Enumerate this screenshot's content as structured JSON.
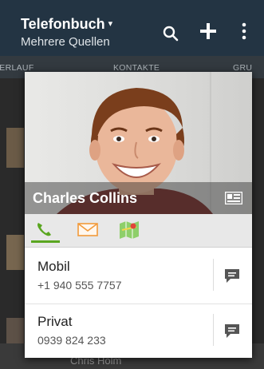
{
  "app": {
    "title": "Telefonbuch",
    "title_caret": "▾",
    "subtitle": "Mehrere Quellen",
    "search_icon": "search-icon",
    "add_icon": "plus-icon",
    "menu_icon": "overflow-menu-icon"
  },
  "tabs": [
    {
      "label": "VERLAUF (partially visible)"
    },
    {
      "label": "KONTAKTE"
    },
    {
      "label": "GRU"
    }
  ],
  "contact": {
    "name": "Charles Collins",
    "card_icon": "contact-card-icon",
    "methods": [
      {
        "icon": "phone-icon",
        "active": true
      },
      {
        "icon": "mail-icon",
        "active": false
      },
      {
        "icon": "map-icon",
        "active": false
      }
    ],
    "entries": [
      {
        "label": "Mobil",
        "value": "+1 940 555 7757",
        "action_icon": "message-icon"
      },
      {
        "label": "Privat",
        "value": "0939 824 233",
        "action_icon": "message-icon"
      }
    ]
  },
  "colors": {
    "header": "#233443",
    "tabbar": "#333a40",
    "accent_green": "#5aa620"
  }
}
